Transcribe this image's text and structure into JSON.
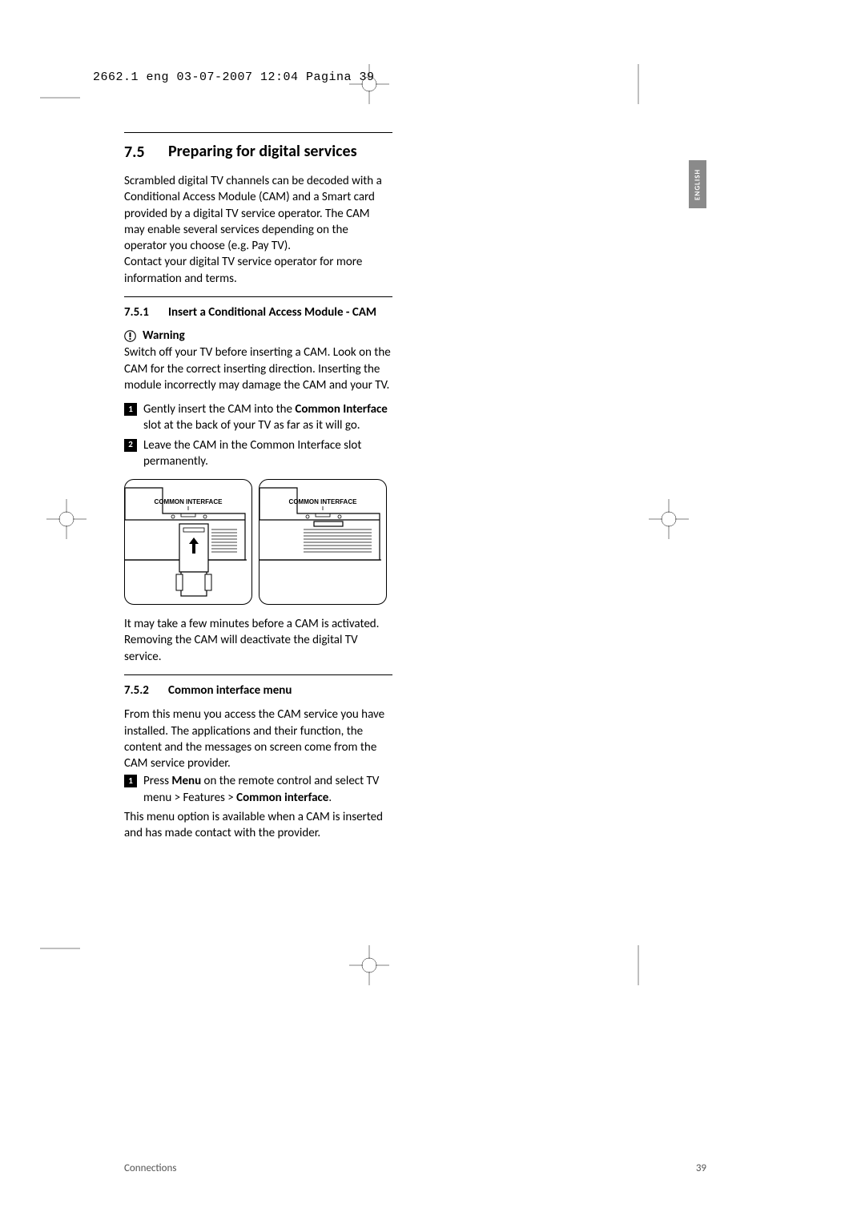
{
  "header": "2662.1 eng  03-07-2007  12:04  Pagina 39",
  "sideTab": "ENGLISH",
  "section": {
    "number": "7.5",
    "title": "Preparing for digital services",
    "intro1": "Scrambled digital TV channels can be decoded with a Conditional Access Module (CAM) and a Smart card provided by a digital TV service operator. The CAM may enable several services depending on the operator you choose (e.g. Pay TV).",
    "intro2": "Contact your digital TV service operator for more information and terms."
  },
  "sub751": {
    "number": "7.5.1",
    "title": "Insert a Conditional Access Module - CAM",
    "warningLabel": "Warning",
    "warningText": "Switch off your TV before inserting a CAM. Look on the CAM for the correct inserting direction. Inserting the module incorrectly may damage the CAM and your TV.",
    "step1a": "Gently insert the CAM into the ",
    "step1bold": "Common Interface",
    "step1b": " slot at the back of your TV as far as it will go.",
    "step2": "Leave the CAM in the Common Interface slot permanently.",
    "diagramLabel": "COMMON INTERFACE",
    "afterText": "It may take a few minutes before a CAM is activated. Removing the CAM will deactivate the digital TV service."
  },
  "sub752": {
    "number": "7.5.2",
    "title": "Common interface menu",
    "intro": "From this menu you access the CAM service you have installed. The applications and their function, the content and the messages on screen come from the CAM service provider.",
    "step1a": "Press ",
    "step1bold1": "Menu",
    "step1b": " on the remote control and select TV menu > Features > ",
    "step1bold2": "Common interface",
    "step1c": ".",
    "afterText": "This menu option is available when a CAM is inserted and has made contact with the provider."
  },
  "footer": {
    "left": "Connections",
    "right": "39"
  }
}
